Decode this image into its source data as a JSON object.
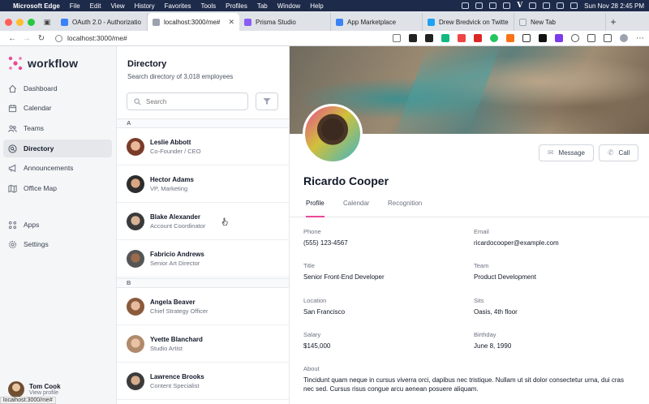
{
  "menubar": {
    "app": "Microsoft Edge",
    "items": [
      "File",
      "Edit",
      "View",
      "History",
      "Favorites",
      "Tools",
      "Profiles",
      "Tab",
      "Window",
      "Help"
    ],
    "clock": "Sun Nov 28  2:45 PM"
  },
  "tabs": [
    {
      "label": "OAuth 2.0 - Authorizatio",
      "fav": "#3b82f6",
      "active": false
    },
    {
      "label": "localhost:3000/me#",
      "fav": "#9ca3af",
      "active": true
    },
    {
      "label": "Prisma Studio",
      "fav": "#8b5cf6",
      "active": false
    },
    {
      "label": "App Marketplace",
      "fav": "#3b82f6",
      "active": false
    },
    {
      "label": "Drew Bredvick on Twitte",
      "fav": "#1da1f2",
      "active": false
    },
    {
      "label": "New Tab",
      "fav": "#e5e7eb",
      "active": false
    }
  ],
  "address": {
    "url": "localhost:3000/me#"
  },
  "app": {
    "brand": "workflow"
  },
  "nav": [
    {
      "label": "Dashboard",
      "icon": "home-icon"
    },
    {
      "label": "Calendar",
      "icon": "calendar-icon"
    },
    {
      "label": "Teams",
      "icon": "users-icon"
    },
    {
      "label": "Directory",
      "icon": "search-circle-icon",
      "active": true
    },
    {
      "label": "Announcements",
      "icon": "speakerphone-icon"
    },
    {
      "label": "Office Map",
      "icon": "map-icon"
    }
  ],
  "nav2": [
    {
      "label": "Apps",
      "icon": "grid-icon"
    },
    {
      "label": "Settings",
      "icon": "gear-icon"
    }
  ],
  "user": {
    "name": "Tom Cook",
    "action": "View profile"
  },
  "status_url": "localhost:3000/me#",
  "directory": {
    "title": "Directory",
    "subtitle": "Search directory of 3,018 employees",
    "search_placeholder": "Search",
    "groups": [
      {
        "letter": "A",
        "people": [
          {
            "name": "Leslie Abbott",
            "role": "Co-Founder / CEO"
          },
          {
            "name": "Hector Adams",
            "role": "VP, Marketing"
          },
          {
            "name": "Blake Alexander",
            "role": "Account Coordinator"
          },
          {
            "name": "Fabricio Andrews",
            "role": "Senior Art Director"
          }
        ]
      },
      {
        "letter": "B",
        "people": [
          {
            "name": "Angela Beaver",
            "role": "Chief Strategy Officer"
          },
          {
            "name": "Yvette Blanchard",
            "role": "Studio Artist"
          },
          {
            "name": "Lawrence Brooks",
            "role": "Content Specialist"
          }
        ]
      }
    ]
  },
  "profile": {
    "name": "Ricardo Cooper",
    "message_label": "Message",
    "call_label": "Call",
    "tabs": [
      "Profile",
      "Calendar",
      "Recognition"
    ],
    "fields": [
      {
        "label": "Phone",
        "value": "(555) 123-4567"
      },
      {
        "label": "Email",
        "value": "ricardocooper@example.com"
      },
      {
        "label": "Title",
        "value": "Senior Front-End Developer"
      },
      {
        "label": "Team",
        "value": "Product Development"
      },
      {
        "label": "Location",
        "value": "San Francisco"
      },
      {
        "label": "Sits",
        "value": "Oasis, 4th floor"
      },
      {
        "label": "Salary",
        "value": "$145,000"
      },
      {
        "label": "Birthday",
        "value": "June 8, 1990"
      }
    ],
    "about_label": "About",
    "about_text": "Tincidunt quam neque in cursus viverra orci, dapibus nec tristique. Nullam ut sit dolor consectetur urna, dui cras nec sed. Cursus risus congue arcu aenean posuere aliquam."
  },
  "colors": {
    "accent": "#ec4899",
    "brand": "#ec4899",
    "menubar": "#1d2a4a"
  }
}
